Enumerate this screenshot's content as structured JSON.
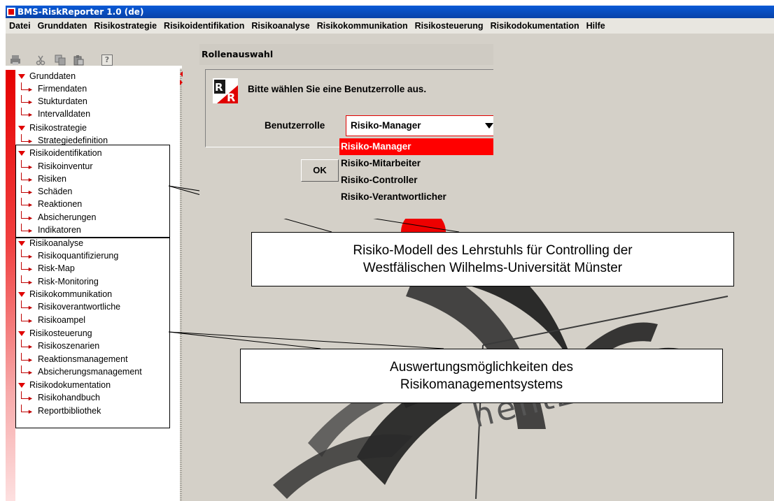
{
  "window": {
    "title": "BMS-RiskReporter 1.0 (de)"
  },
  "menu": [
    "Datei",
    "Grunddaten",
    "Risikostrategie",
    "Risikoidentifikation",
    "Risikoanalyse",
    "Risikokommunikation",
    "Risikosteuerung",
    "Risikodokumentation",
    "Hilfe"
  ],
  "toolbar": {
    "help_glyph": "?"
  },
  "tree": [
    {
      "label": "Grunddaten",
      "children": [
        "Firmendaten",
        "Stukturdaten",
        "Intervalldaten"
      ]
    },
    {
      "label": "Risikostrategie",
      "children": [
        "Strategiedefinition"
      ]
    },
    {
      "label": "Risikoidentifikation",
      "children": [
        "Risikoinventur",
        "Risiken",
        "Schäden",
        "Reaktionen",
        "Absicherungen",
        "Indikatoren"
      ]
    },
    {
      "label": "Risikoanalyse",
      "children": [
        "Risikoquantifizierung",
        "Risk-Map",
        "Risk-Monitoring"
      ]
    },
    {
      "label": "Risikokommunikation",
      "children": [
        "Risikoverantwortliche",
        "Risikoampel"
      ]
    },
    {
      "label": "Risikosteuerung",
      "children": [
        "Risikoszenarien",
        "Reaktionsmanagement",
        "Absicherungsmanagement"
      ]
    },
    {
      "label": "Risikodokumentation",
      "children": [
        "Risikohandbuch",
        "Reportbibliothek"
      ]
    }
  ],
  "dialog": {
    "title": "Rollenauswahl",
    "message": "Bitte wählen Sie eine Benutzerrolle aus.",
    "field_label": "Benutzerrolle",
    "selected": "Risiko-Manager",
    "options": [
      "Risiko-Manager",
      "Risiko-Mitarbeiter",
      "Risiko-Controller",
      "Risiko-Verantwortlicher"
    ],
    "ok_label": "OK"
  },
  "callouts": [
    {
      "lines": [
        "Risiko-Modell des Lehrstuhls für Controlling der",
        "Westfälischen Wilhelms-Universität Münster"
      ]
    },
    {
      "lines": [
        "Auswertungsmöglichkeiten des",
        "Risikomanagementsystems"
      ]
    }
  ],
  "background_text": "hentzündlich",
  "colors": {
    "accent": "#e00000",
    "title_bar": "#0a5ad6",
    "panel": "#d4d0c8"
  }
}
